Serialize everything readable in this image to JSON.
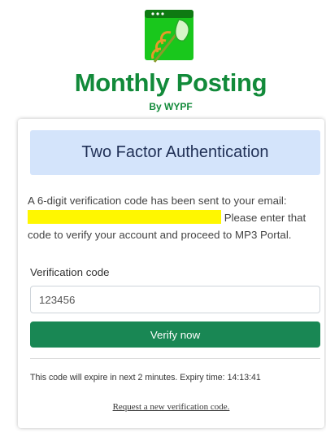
{
  "brand": {
    "title": "Monthly Posting",
    "byline": "By WYPF",
    "logo_icon": "browser-leaf-logo-icon",
    "color": "#128a3a"
  },
  "card": {
    "header": "Two Factor Authentication",
    "message_line1": "A 6-digit verification code has been sent to your email:",
    "message_line2_suffix": "Please enter that",
    "message_line3": "code to verify your account and proceed to MP3 Portal.",
    "field_label": "Verification code",
    "code_value": "123456",
    "verify_label": "Verify now",
    "expiry_text": "This code will expire in next 2 minutes. Expiry time: 14:13:41",
    "resend_label": "Request a new verification code."
  },
  "colors": {
    "header_bg": "#d4e4fb",
    "button_bg": "#198754",
    "redaction": "#fff700"
  }
}
